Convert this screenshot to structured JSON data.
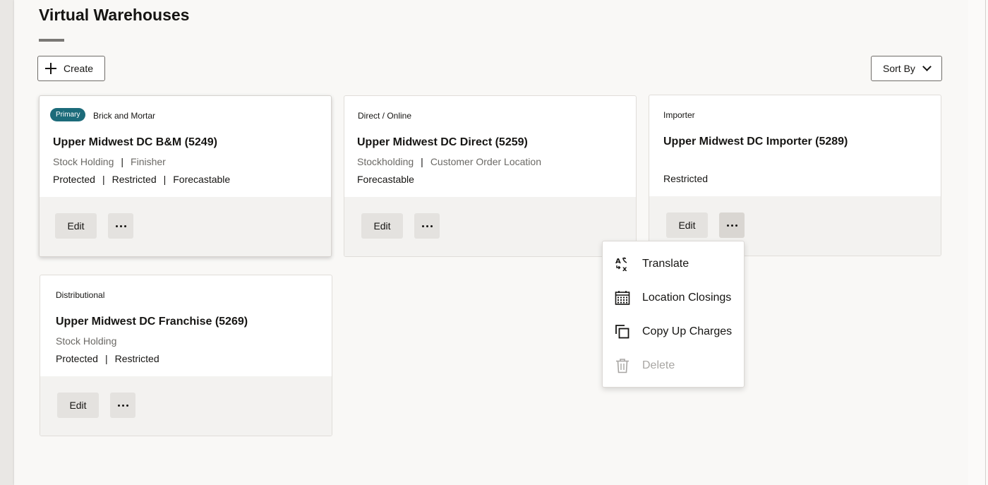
{
  "page": {
    "title": "Virtual Warehouses",
    "create_label": "Create",
    "sort_label": "Sort By"
  },
  "cards": [
    {
      "badge": "Primary",
      "type": "Brick and Mortar",
      "title": "Upper Midwest DC B&M (5249)",
      "line1": [
        "Stock Holding",
        "Finisher"
      ],
      "line2": [
        "Protected",
        "Restricted",
        "Forecastable"
      ],
      "edit_label": "Edit"
    },
    {
      "type": "Direct / Online",
      "title": "Upper Midwest DC Direct (5259)",
      "line1": [
        "Stockholding",
        "Customer Order Location"
      ],
      "line2": [
        "Forecastable"
      ],
      "edit_label": "Edit"
    },
    {
      "type": "Importer",
      "title": "Upper Midwest DC Importer (5289)",
      "line1": [],
      "line2": [
        "Restricted"
      ],
      "edit_label": "Edit"
    },
    {
      "type": "Distributional",
      "title": "Upper Midwest DC Franchise (5269)",
      "line1": [
        "Stock Holding"
      ],
      "line2": [
        "Protected",
        "Restricted"
      ],
      "edit_label": "Edit"
    }
  ],
  "menu": {
    "items": [
      {
        "label": "Translate",
        "icon": "translate-icon",
        "disabled": false
      },
      {
        "label": "Location Closings",
        "icon": "calendar-icon",
        "disabled": false
      },
      {
        "label": "Copy Up Charges",
        "icon": "copy-icon",
        "disabled": false
      },
      {
        "label": "Delete",
        "icon": "trash-icon",
        "disabled": true
      }
    ]
  },
  "colors": {
    "badge": "#1c6b7a",
    "footer": "#f3f2f0",
    "button": "#e4e2df",
    "disabled_text": "#a8a6a3"
  }
}
